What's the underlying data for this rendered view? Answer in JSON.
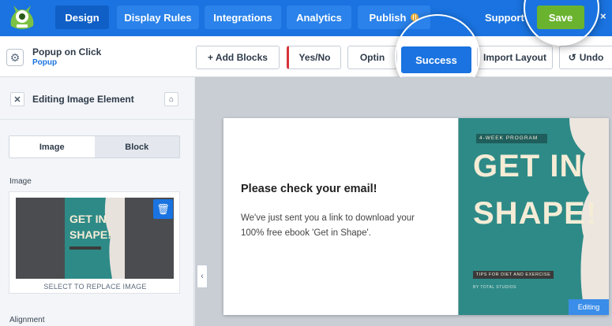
{
  "nav": {
    "tabs": [
      {
        "label": "Design",
        "active": true
      },
      {
        "label": "Display Rules",
        "active": false
      },
      {
        "label": "Integrations",
        "active": false
      },
      {
        "label": "Analytics",
        "active": false
      },
      {
        "label": "Publish",
        "active": false
      }
    ],
    "support_label": "Support",
    "save_label": "Save",
    "close_label": "×"
  },
  "campaign": {
    "title": "Popup on Click",
    "type": "Popup"
  },
  "toolbar": {
    "add_blocks_label": "+ Add Blocks",
    "views": [
      "Yes/No",
      "Optin",
      "Success"
    ],
    "active_view": "Success",
    "import_layout_label": "Import Layout",
    "undo_label": "Undo"
  },
  "sidebar": {
    "title": "Editing Image Element",
    "tabs": [
      "Image",
      "Block"
    ],
    "active_tab": "Image",
    "image_label": "Image",
    "replace_label": "SELECT TO REPLACE IMAGE",
    "alignment_label": "Alignment"
  },
  "popup": {
    "heading": "Please check your email!",
    "body": "We've just sent you a link to download your 100% free ebook 'Get in Shape'.",
    "cover": {
      "kicker": "4-WEEK PROGRAM",
      "title_line1": "GET IN",
      "title_line2": "SHAPE!",
      "subtitle": "TIPS FOR DIET AND EXERCISE",
      "publisher": "BY TOTAL STUDIOS"
    },
    "editing_badge": "Editing"
  },
  "colors": {
    "primary": "#1a73e0",
    "save": "#6ab32f",
    "cover": "#2e8a87",
    "yesno_marker": "#d6343b"
  }
}
